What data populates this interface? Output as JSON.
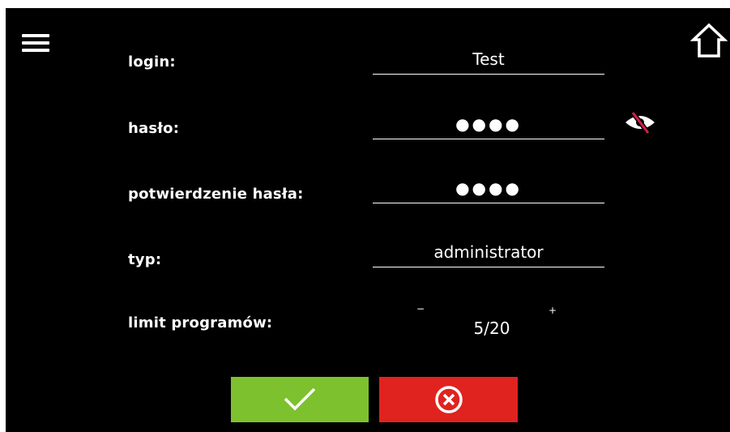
{
  "form": {
    "login_label": "login:",
    "login_value": "Test",
    "password_label": "hasło:",
    "password_value": "●●●●",
    "confirm_label": "potwierdzenie hasła:",
    "confirm_value": "●●●●",
    "type_label": "typ:",
    "type_value": "administrator",
    "limit_label": "limit programów:",
    "limit_value": "5/20",
    "limit_minus": "−",
    "limit_plus": "+"
  },
  "icons": {
    "menu": "hamburger-menu-icon",
    "home": "home-icon",
    "visibility": "eye-slash-icon",
    "confirm": "checkmark-icon",
    "cancel": "circle-x-icon"
  },
  "colors": {
    "background": "#000000",
    "confirm_button": "#7dc12e",
    "cancel_button": "#e0231f",
    "eye_slash": "#d21f4a"
  }
}
